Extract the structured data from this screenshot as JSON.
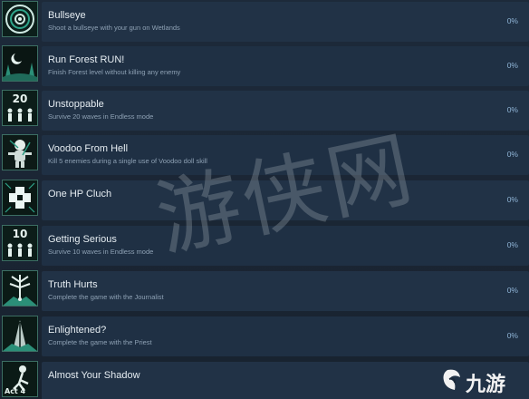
{
  "achievements": [
    {
      "title": "Bullseye",
      "description": "Shoot a bullseye with your gun on Wetlands",
      "percent": "0%",
      "icon": "target-icon",
      "icon_text": ""
    },
    {
      "title": "Run Forest RUN!",
      "description": "Finish Forest level without killing any enemy",
      "percent": "0%",
      "icon": "forest-moon-icon",
      "icon_text": ""
    },
    {
      "title": "Unstoppable",
      "description": "Survive 20 waves in Endless mode",
      "percent": "0%",
      "icon": "waves-20-icon",
      "icon_text": "20"
    },
    {
      "title": "Voodoo From Hell",
      "description": "Kill 5 enemies during a single use of Voodoo doll skill",
      "percent": "0%",
      "icon": "voodoo-doll-icon",
      "icon_text": ""
    },
    {
      "title": "One HP Cluch",
      "description": "",
      "percent": "0%",
      "icon": "health-cross-icon",
      "icon_text": ""
    },
    {
      "title": "Getting Serious",
      "description": "Survive 10 waves in Endless mode",
      "percent": "0%",
      "icon": "waves-10-icon",
      "icon_text": "10"
    },
    {
      "title": "Truth Hurts",
      "description": "Complete the game with the Journalist",
      "percent": "0%",
      "icon": "tree-figure-icon",
      "icon_text": ""
    },
    {
      "title": "Enlightened?",
      "description": "Complete the game with the Priest",
      "percent": "0%",
      "icon": "tree-light-icon",
      "icon_text": ""
    },
    {
      "title": "Almost Your Shadow",
      "description": "",
      "percent": "",
      "icon": "act4-figure-icon",
      "icon_text": "Act 4"
    }
  ],
  "watermark": "游侠网",
  "logo_text": "九游",
  "colors": {
    "background": "#1b2838",
    "row": "#1f3044",
    "icon_border": "#3c6e63",
    "title": "#e6edf2",
    "description": "#8ea1b4",
    "percent": "#8fb4d6"
  }
}
